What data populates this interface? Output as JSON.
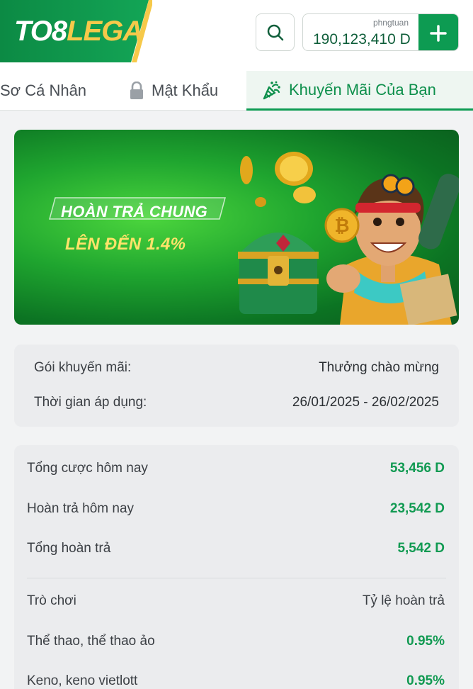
{
  "brand": {
    "logo_part1": "TO8",
    "logo_part2": "LEGA",
    "green": "#0d9b52",
    "yellow": "#f6c94a"
  },
  "header": {
    "search_icon": "search-icon",
    "username": "phngtuan",
    "balance": "190,123,410 D",
    "deposit_icon": "plus-icon"
  },
  "tabs": [
    {
      "label": "Sơ Cá Nhân",
      "icon": ""
    },
    {
      "label": "Mật Khẩu",
      "icon": "lock-icon"
    },
    {
      "label": "Khuyến Mãi Của Bạn",
      "icon": "party-popper-icon",
      "active": true
    }
  ],
  "banner": {
    "line1": "HOÀN TRẢ CHUNG",
    "line2": "LÊN ĐẾN 1.4%"
  },
  "promo_info": {
    "package_label": "Gói khuyến mãi:",
    "package_value": "Thưởng chào mừng",
    "period_label": "Thời gian áp dụng:",
    "period_value": "26/01/2025 - 26/02/2025"
  },
  "stats": {
    "today_bets_label": "Tổng cược hôm nay",
    "today_bets_value": "53,456 D",
    "today_refund_label": "Hoàn trả hôm nay",
    "today_refund_value": "23,542 D",
    "total_refund_label": "Tổng hoàn trả",
    "total_refund_value": "5,542 D"
  },
  "rates": {
    "col_game": "Trò chơi",
    "col_rate": "Tỷ lệ hoàn trả",
    "rows": [
      {
        "game": "Thể thao, thể thao ảo",
        "rate": "0.95%"
      },
      {
        "game": "Keno, keno vietlott",
        "rate": "0.95%"
      }
    ]
  }
}
